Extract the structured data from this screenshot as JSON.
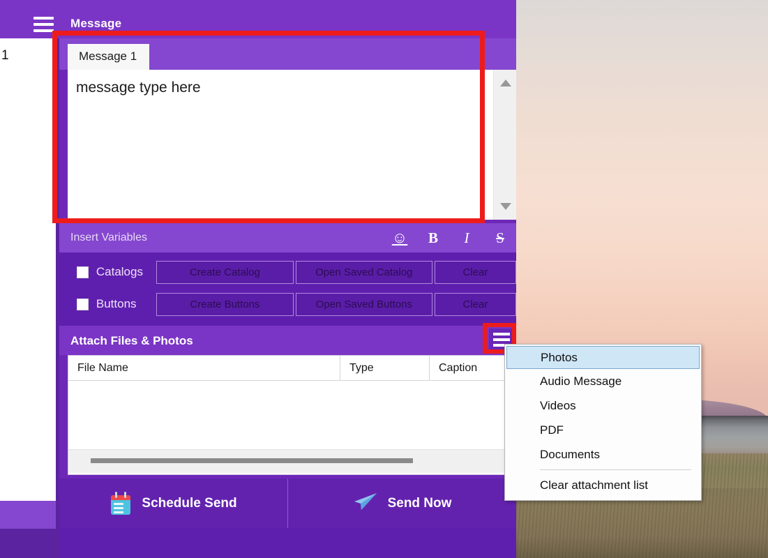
{
  "window": {
    "header_title": "Message",
    "hamburger_icon": "hamburger-icon"
  },
  "left_panel": {
    "list_item_number": "1"
  },
  "editor": {
    "tab_label": "Message 1",
    "content": "message type here",
    "scroll_up_icon": "triangle-up-icon",
    "scroll_down_icon": "triangle-down-icon"
  },
  "insert_variables": {
    "label": "Insert Variables",
    "tools": [
      {
        "name": "emoji-icon",
        "glyph": "☺"
      },
      {
        "name": "bold-icon",
        "glyph": "B"
      },
      {
        "name": "italic-icon",
        "glyph": "I"
      },
      {
        "name": "strikethrough-icon",
        "glyph": "S"
      }
    ]
  },
  "options": {
    "catalogs": {
      "label": "Catalogs",
      "create": "Create Catalog",
      "open_saved": "Open Saved Catalog",
      "clear": "Clear",
      "checked": false
    },
    "buttons": {
      "label": "Buttons",
      "create": "Create Buttons",
      "open_saved": "Open Saved Buttons",
      "clear": "Clear",
      "checked": false
    }
  },
  "attachments": {
    "header_title": "Attach Files & Photos",
    "menu_button_icon": "hamburger-icon",
    "columns": [
      "File Name",
      "Type",
      "Caption"
    ],
    "rows": []
  },
  "attachment_menu": {
    "items": [
      {
        "label": "Photos",
        "selected": true
      },
      {
        "label": "Audio Message",
        "selected": false
      },
      {
        "label": "Videos",
        "selected": false
      },
      {
        "label": "PDF",
        "selected": false
      },
      {
        "label": "Documents",
        "selected": false
      }
    ],
    "clear_item": "Clear attachment list"
  },
  "actions": {
    "schedule_send": "Schedule Send",
    "schedule_icon": "calendar-icon",
    "send_now": "Send Now",
    "send_icon": "paper-plane-icon"
  },
  "colors": {
    "header_purple": "#7b35c6",
    "panel_purple": "#5f1fae",
    "accent_purple": "#8547cf",
    "annotation_red": "#ee1b1b",
    "menu_highlight": "#cfe6f7"
  }
}
